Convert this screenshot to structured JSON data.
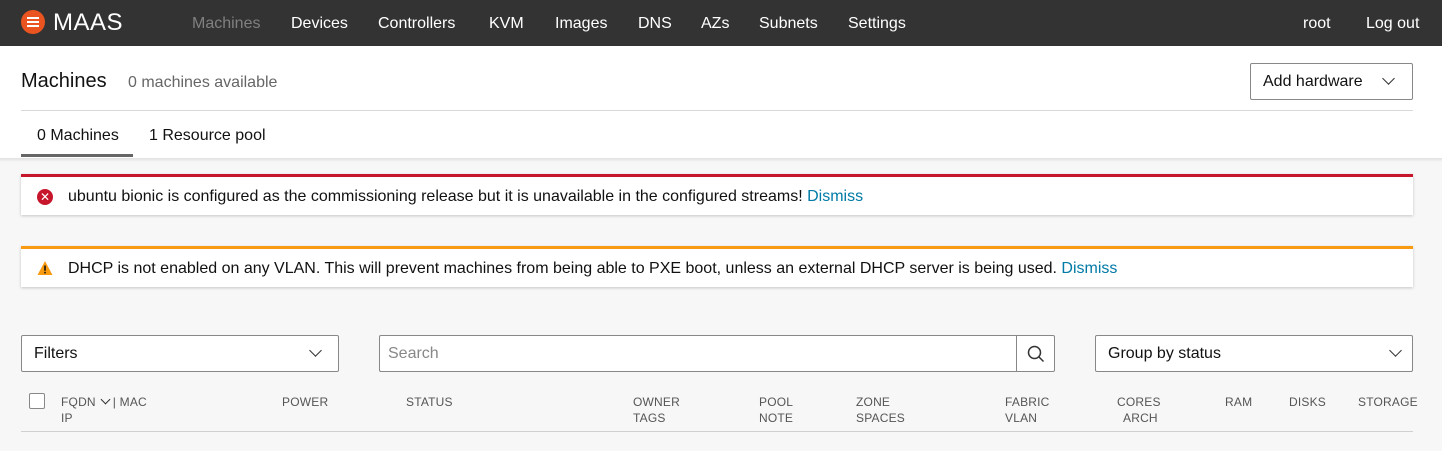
{
  "app": {
    "name": "MAAS",
    "brand_color": "#e95420",
    "logo_icon": "maas-menu-icon"
  },
  "nav": {
    "items": [
      {
        "label": "Machines",
        "active": true
      },
      {
        "label": "Devices"
      },
      {
        "label": "Controllers"
      },
      {
        "label": "KVM"
      },
      {
        "label": "Images"
      },
      {
        "label": "DNS"
      },
      {
        "label": "AZs"
      },
      {
        "label": "Subnets"
      },
      {
        "label": "Settings"
      }
    ],
    "user": "root",
    "logout": "Log out"
  },
  "header": {
    "title": "Machines",
    "subtitle": "0 machines available",
    "add_hardware": "Add hardware",
    "tabs": [
      {
        "label": "0 Machines",
        "active": true
      },
      {
        "label": "1 Resource pool"
      }
    ]
  },
  "notifications": [
    {
      "type": "error",
      "color": "#c7162b",
      "message": "ubuntu bionic is configured as the commissioning release but it is unavailable in the configured streams!",
      "action": "Dismiss"
    },
    {
      "type": "warning",
      "color": "#f99b11",
      "message": "DHCP is not enabled on any VLAN. This will prevent machines from being able to PXE boot, unless an external DHCP server is being used.",
      "action": "Dismiss"
    }
  ],
  "controls": {
    "filters_label": "Filters",
    "search_placeholder": "Search",
    "group_by": "Group by status"
  },
  "table": {
    "columns": {
      "fqdn": "FQDN",
      "mac": "| MAC",
      "ip": "IP",
      "power": "POWER",
      "status": "STATUS",
      "owner": "OWNER",
      "tags": "TAGS",
      "pool": "POOL",
      "note": "NOTE",
      "zone": "ZONE",
      "spaces": "SPACES",
      "fabric": "FABRIC",
      "vlan": "VLAN",
      "cores": "CORES",
      "arch": "ARCH",
      "ram": "RAM",
      "disks": "DISKS",
      "storage": "STORAGE"
    }
  }
}
